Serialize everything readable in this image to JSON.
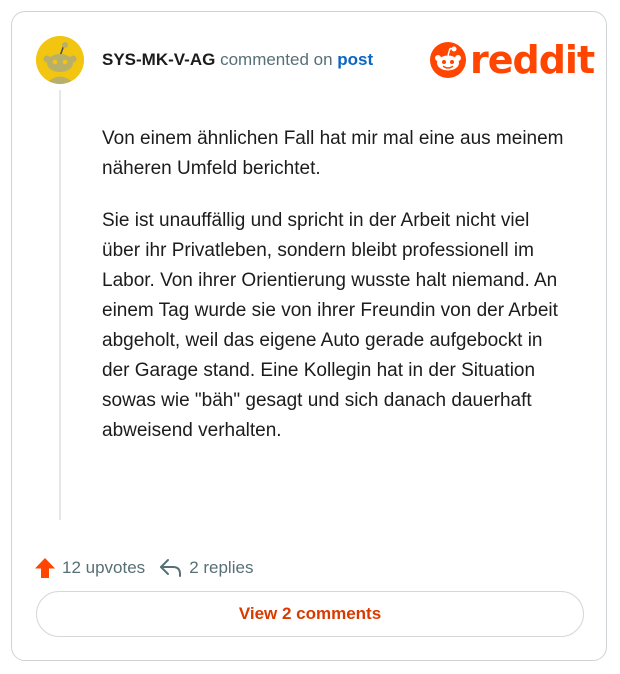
{
  "comment": {
    "username": "SYS-MK-V-AG",
    "action_text": "commented on",
    "post_link": "post",
    "paragraphs": [
      "Von einem ähnlichen Fall hat mir mal eine aus meinem näheren Umfeld berichtet.",
      "Sie ist unauffällig und spricht in der Arbeit nicht viel über ihr Privatleben, sondern bleibt professionell im Labor. Von ihrer Orientierung wusste halt niemand. An einem Tag wurde sie von ihrer Freundin von der Arbeit abgeholt, weil das eigene Auto gerade aufgebockt in der Garage stand. Eine Kollegin hat in der Situation sowas wie \"bäh\" gesagt und sich danach dauerhaft abweisend verhalten."
    ],
    "upvotes_label": "12 upvotes",
    "replies_label": "2 replies",
    "view_comments_label": "View 2 comments"
  },
  "brand": {
    "name": "reddit",
    "color": "#ff4500"
  },
  "avatar": {
    "color": "#f2c511",
    "icon": "snoo-avatar-icon"
  },
  "icons": {
    "upvote": "upvote-arrow-icon",
    "reply": "reply-arrow-icon"
  }
}
